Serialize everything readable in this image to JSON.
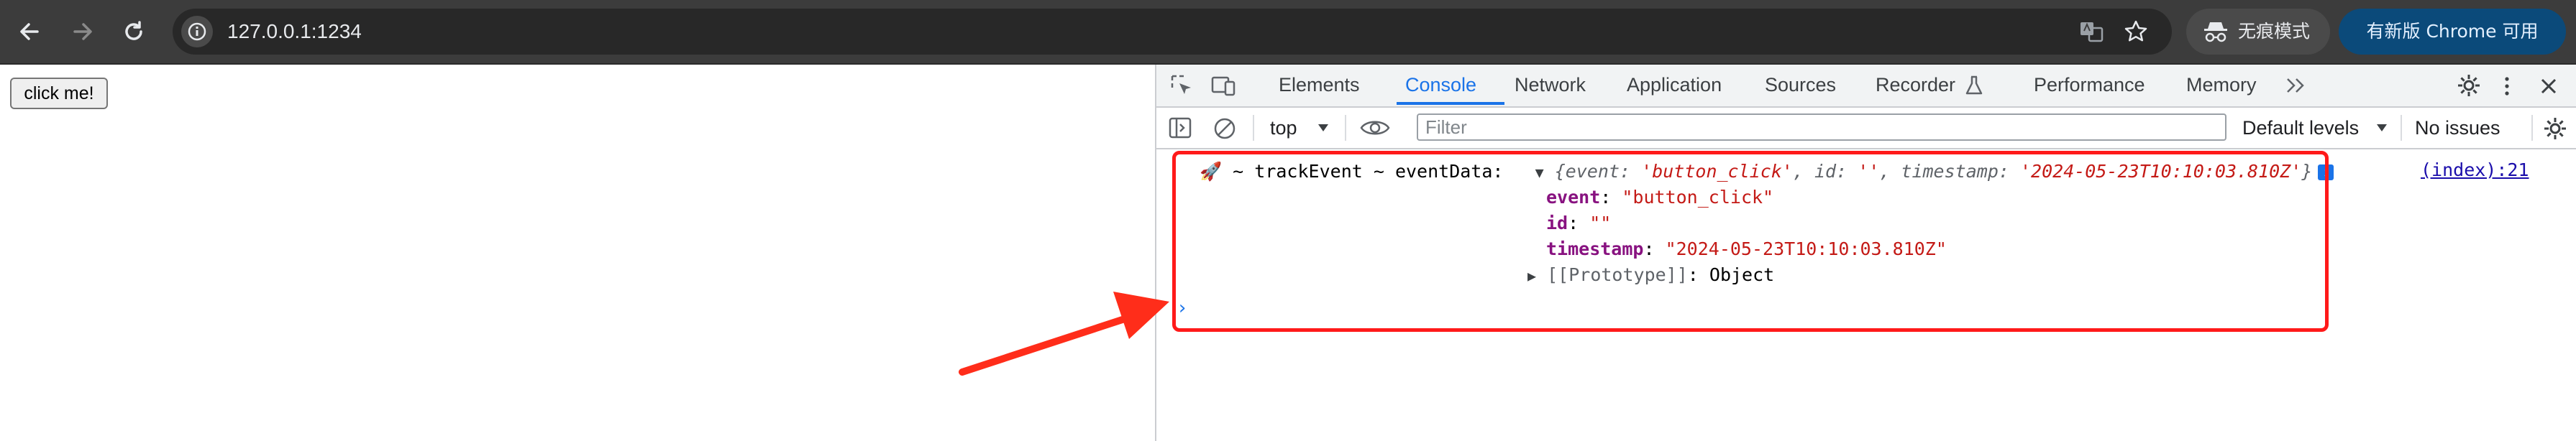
{
  "browser": {
    "url": "127.0.0.1:1234",
    "incognito_label": "无痕模式",
    "update_label": "有新版 Chrome 可用",
    "icons": [
      "back-icon",
      "forward-icon",
      "reload-icon",
      "site-info-icon",
      "translate-icon",
      "bookmark-star-icon",
      "incognito-icon"
    ]
  },
  "page": {
    "button_label": "click me!"
  },
  "devtools": {
    "tabs": [
      {
        "label": "Elements"
      },
      {
        "label": "Console"
      },
      {
        "label": "Network"
      },
      {
        "label": "Application"
      },
      {
        "label": "Sources"
      },
      {
        "label": "Recorder"
      },
      {
        "label": "Performance"
      },
      {
        "label": "Memory"
      }
    ],
    "active_tab": "Console",
    "toolbar": {
      "context": "top",
      "filter_placeholder": "Filter",
      "levels": "Default levels",
      "issues": "No issues"
    },
    "log": {
      "prefix": "🚀 ~ trackEvent ~ eventData:",
      "preview_open": "{",
      "preview_event_key": "event",
      "preview_event_val": "'button_click'",
      "preview_id_key": "id",
      "preview_id_val": "''",
      "preview_ts_key": "timestamp",
      "preview_ts_val": "'2024-05-23T10:10:03.810Z'",
      "preview_close": "}",
      "props": [
        {
          "key": "event",
          "value": "\"button_click\""
        },
        {
          "key": "id",
          "value": "\"\""
        },
        {
          "key": "timestamp",
          "value": "\"2024-05-23T10:10:03.810Z\""
        }
      ],
      "prototype_label": "[[Prototype]]",
      "prototype_value": "Object",
      "source": "(index):21"
    }
  },
  "colors": {
    "accent": "#1a73e8",
    "highlight": "#ff1a1a",
    "key": "#881280",
    "string": "#c41a16"
  }
}
